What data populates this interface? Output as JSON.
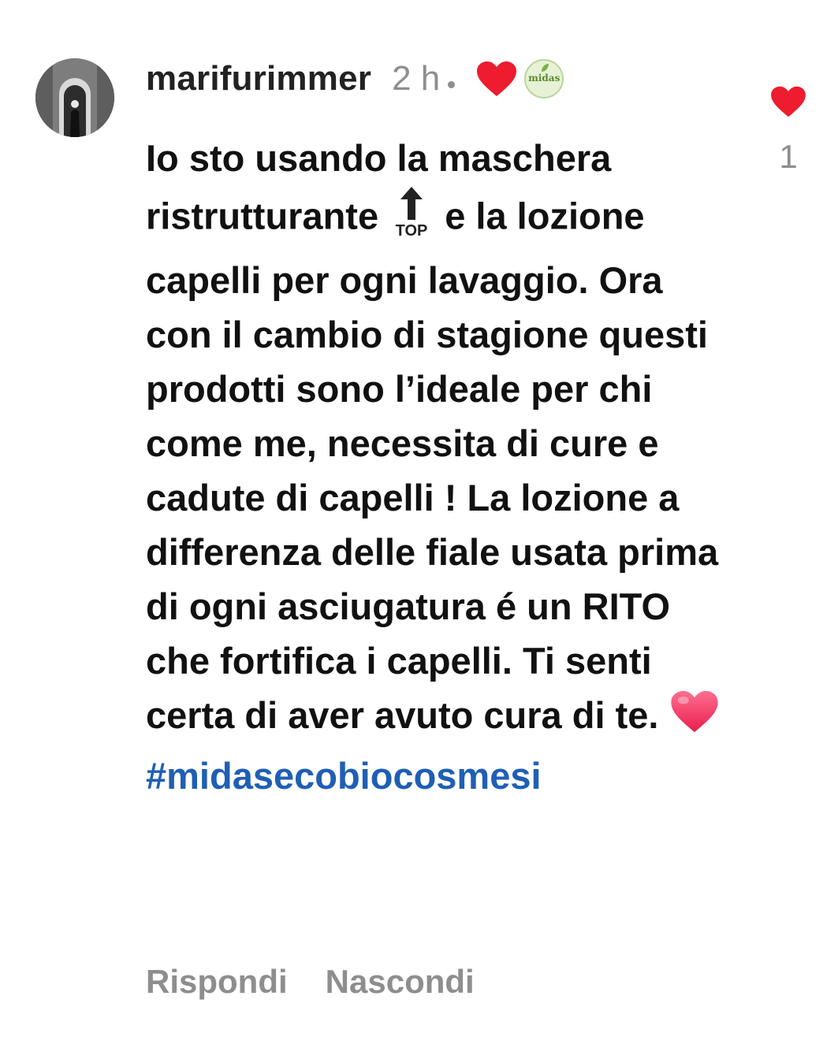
{
  "comment": {
    "username": "marifurimmer",
    "time": "2 h",
    "creator_logo_text": "midas",
    "text_part1": "Io sto usando la maschera ristrutturante",
    "emoji_top_label": "TOP",
    "text_part2": "e la lozione capelli per ogni lavaggio. Ora con il cambio di stagione questi prodotti sono l’ideale per chi come me, necessita di cure e cadute di capelli ! La lozione a differenza delle fiale usata prima di ogni asciugatura é un RITO che fortifica i capelli. Ti senti certa di aver avuto cura di te.",
    "hashtag": "#midasecobiocosmesi",
    "like_count": "1"
  },
  "actions": {
    "reply_label": "Rispondi",
    "hide_label": "Nascondi"
  },
  "icons": {
    "creator_heart": "red-heart-icon",
    "creator_badge": "midas-logo",
    "top_emoji": "top-arrow-emoji",
    "pink_heart": "pink-heart-emoji",
    "like": "like-heart-icon"
  },
  "colors": {
    "username": "#222222",
    "secondary_text": "#8e8e8e",
    "hashtag": "#1f5fb4",
    "heart_red": "#ed1c2e",
    "heart_pink": "#f2315c"
  }
}
